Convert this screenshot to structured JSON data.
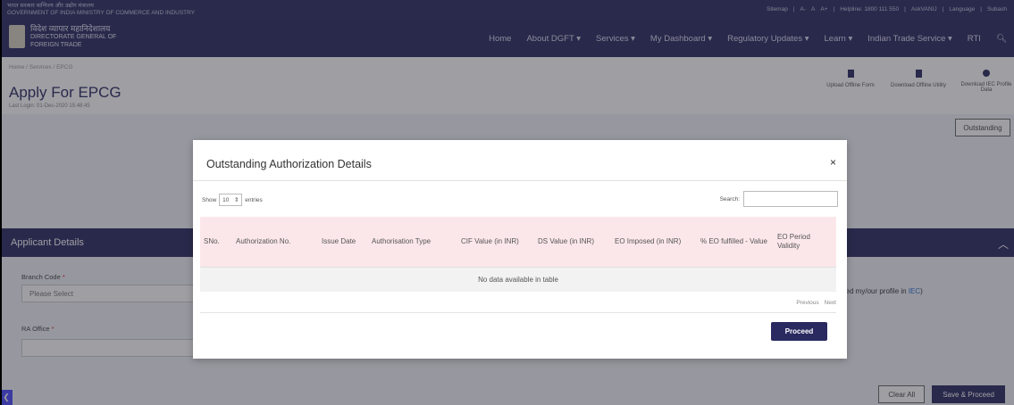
{
  "gov_strip": {
    "line1": "भारत सरकार  वाणिज्य और उद्योग मंत्रालय",
    "line2": "GOVERNMENT OF INDIA  MINISTRY OF COMMERCE AND INDUSTRY",
    "links": [
      "Sitemap",
      "|",
      "A-",
      "A",
      "A+",
      "|",
      "Helpline: 1800 111 550",
      "|",
      "AskVANIJ",
      "|",
      "Language",
      "|",
      "Subash"
    ]
  },
  "logo": {
    "hindi": "विदेश व्यापार महानिदेशालय",
    "line1": "DIRECTORATE GENERAL OF",
    "line2": "FOREIGN TRADE"
  },
  "nav": [
    "Home",
    "About DGFT",
    "Services",
    "My Dashboard",
    "Regulatory Updates",
    "Learn",
    "Indian Trade Service",
    "RTI"
  ],
  "page": {
    "breadcrumb": "Home / Services / EPCG",
    "title": "Apply For EPCG",
    "last_login": "Last Login: 01-Dec-2020 15:48:45",
    "actions": [
      "Upload Offline Form",
      "Download Offline Utility",
      "Download IEC Profile Data"
    ]
  },
  "background": {
    "outstanding_btn": "Outstanding",
    "applicant_details": "Applicant Details",
    "branch_code_label": "Branch Code",
    "branch_code_value": "Please Select",
    "ra_office_label": "RA Office",
    "iec_note": "lied my/our profile in",
    "iec_link": "IEC",
    "iec_tail": ")",
    "clear_all": "Clear All",
    "save_proceed": "Save & Proceed"
  },
  "modal": {
    "title": "Outstanding Authorization Details",
    "close": "×",
    "show": "Show",
    "entries_value": "10",
    "entries": "entries",
    "search_label": "Search:",
    "columns": [
      "SNo.",
      "Authorization No.",
      "Issue Date",
      "Authorisation Type",
      "CIF Value (in INR)",
      "DS Value (in INR)",
      "EO Imposed (in INR)",
      "% EO fulfilled - Value",
      "EO Period Validity"
    ],
    "empty_message": "No data available in table",
    "previous": "Previous",
    "next": "Next",
    "proceed": "Proceed"
  }
}
